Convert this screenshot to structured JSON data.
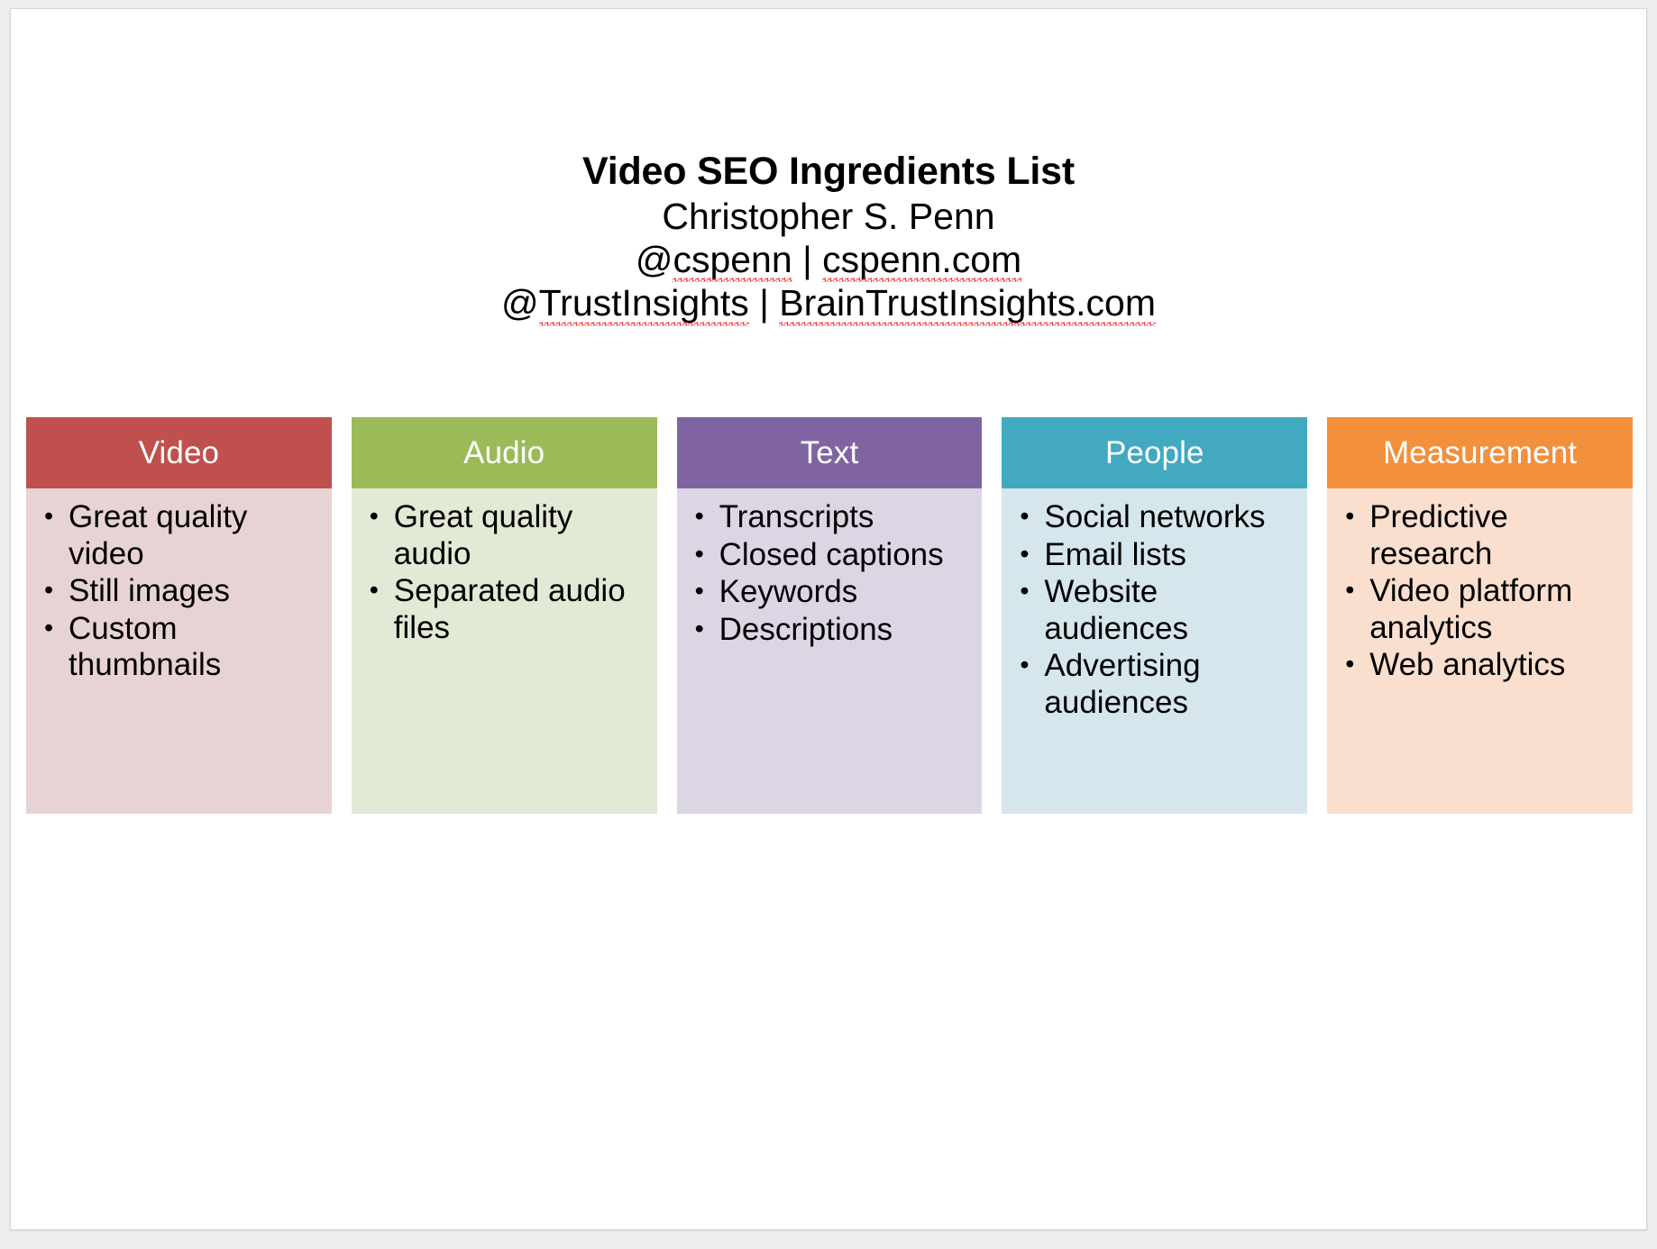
{
  "slide": {
    "title": {
      "heading": "Video SEO Ingredients List",
      "author": "Christopher S. Penn",
      "handle_line_1_part_1": "@cspenn",
      "handle_line_1_separator": " | ",
      "handle_line_1_part_2": "cspenn.com",
      "handle_line_2_part_1": "@TrustInsights",
      "handle_line_2_separator": " | ",
      "handle_line_2_part_2": "BrainTrustInsights.com"
    },
    "columns": [
      {
        "header": "Video",
        "header_color": "#c0504d",
        "body_color": "#e7d3d4",
        "items": [
          "Great quality video",
          "Still images",
          "Custom thumbnails"
        ]
      },
      {
        "header": "Audio",
        "header_color": "#9bbb59",
        "body_color": "#e2e9d5",
        "items": [
          "Great quality audio",
          "Separated audio files"
        ]
      },
      {
        "header": "Text",
        "header_color": "#8064a2",
        "body_color": "#dcd5e4",
        "items": [
          "Transcripts",
          "Closed captions",
          "Keywords",
          "Descriptions"
        ]
      },
      {
        "header": "People",
        "header_color": "#42a9c0",
        "body_color": "#d5e6ec",
        "items": [
          "Social networks",
          "Email lists",
          "Website audiences",
          "Advertising audiences"
        ]
      },
      {
        "header": "Measurement",
        "header_color": "#f2903c",
        "body_color": "#fadfcf",
        "items": [
          "Predictive research",
          "Video platform analytics",
          "Web analytics"
        ]
      }
    ]
  }
}
